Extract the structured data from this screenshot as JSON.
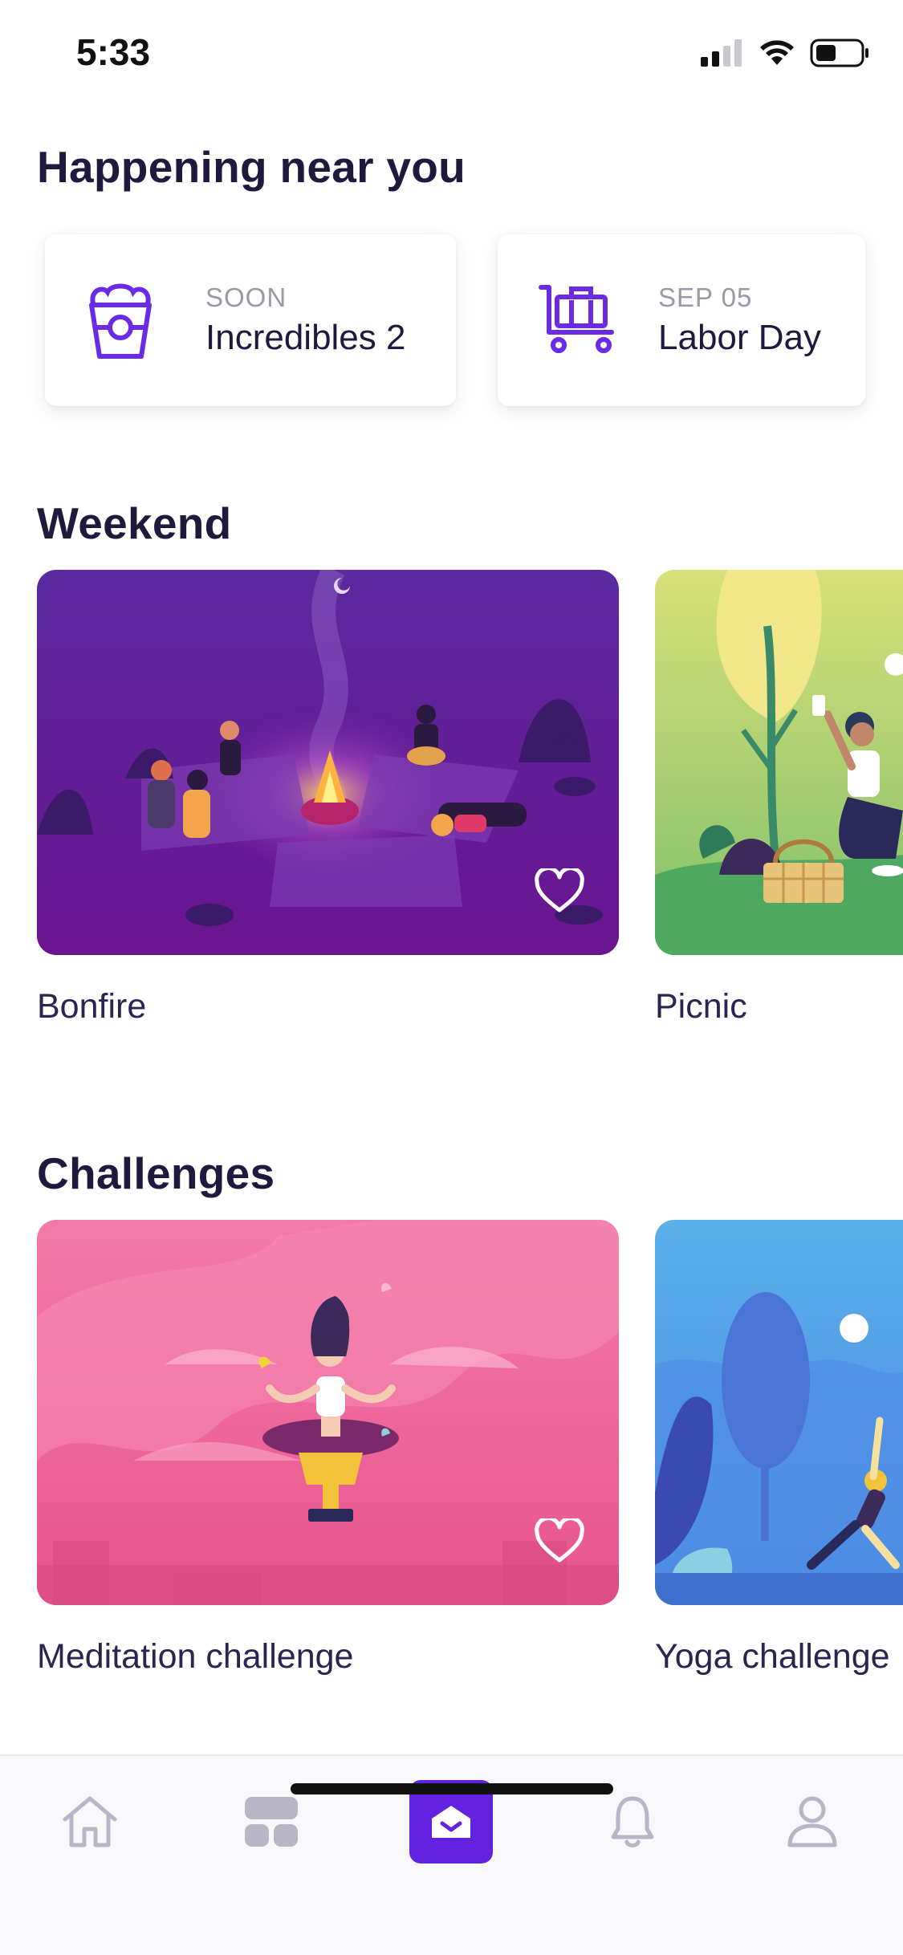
{
  "status_bar": {
    "time": "5:33"
  },
  "happening": {
    "title": "Happening near you",
    "events": [
      {
        "meta": "SOON",
        "name": "Incredibles 2",
        "icon": "popcorn-icon"
      },
      {
        "meta": "SEP 05",
        "name": "Labor Day",
        "icon": "luggage-cart-icon"
      }
    ]
  },
  "weekend": {
    "title": "Weekend",
    "cards": [
      {
        "caption": "Bonfire"
      },
      {
        "caption": "Picnic"
      }
    ]
  },
  "challenges": {
    "title": "Challenges",
    "cards": [
      {
        "caption": "Meditation challenge"
      },
      {
        "caption": "Yoga challenge"
      }
    ]
  },
  "tab_bar": {
    "tabs": [
      {
        "icon": "home-icon",
        "active": false
      },
      {
        "icon": "grid-icon",
        "active": false
      },
      {
        "icon": "inbox-icon",
        "active": true
      },
      {
        "icon": "bell-icon",
        "active": false
      },
      {
        "icon": "profile-icon",
        "active": false
      }
    ]
  },
  "colors": {
    "accent": "#6321e0",
    "heading": "#1f1a3d",
    "muted": "#9a98a6"
  }
}
